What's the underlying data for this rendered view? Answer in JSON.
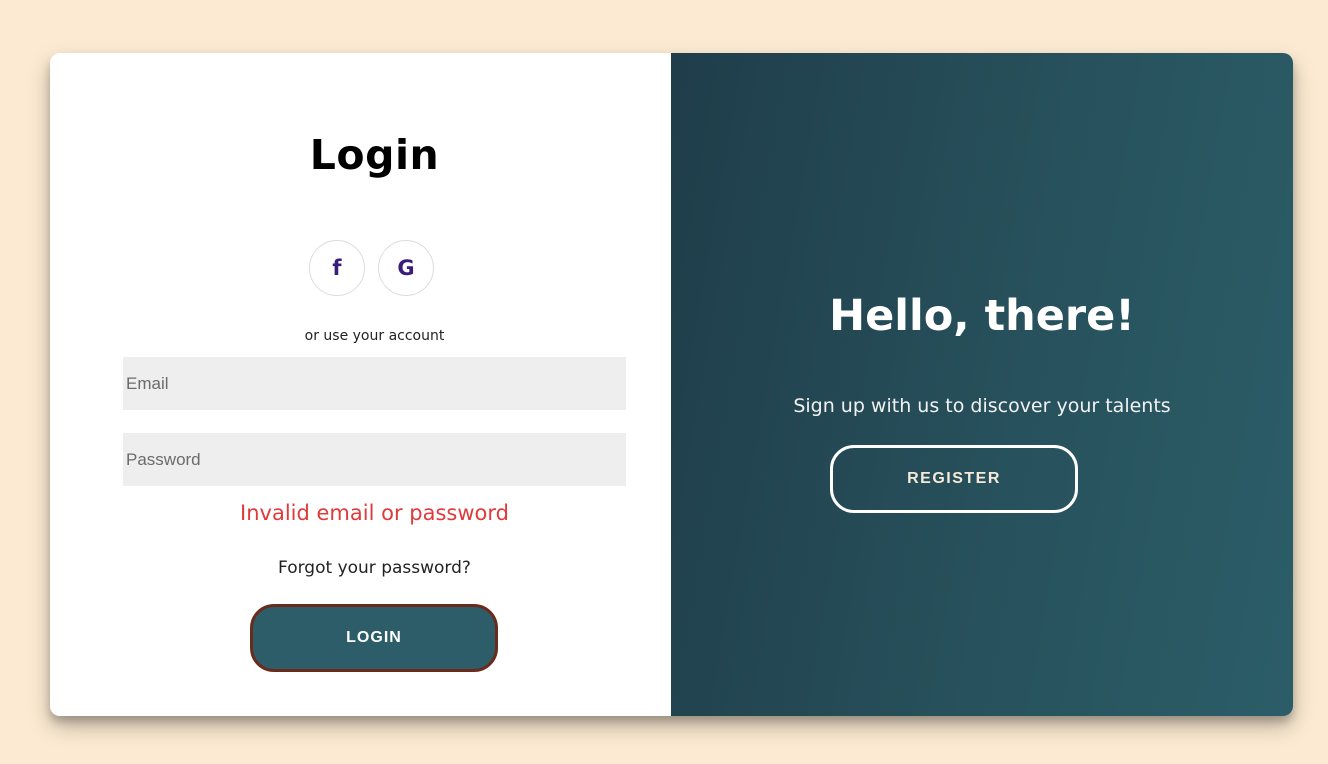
{
  "login": {
    "title": "Login",
    "socials": [
      {
        "label": "f",
        "icon": "facebook-icon"
      },
      {
        "label": "G",
        "icon": "google-icon"
      }
    ],
    "divider_text": "or use your account",
    "email_placeholder": "Email",
    "password_placeholder": "Password",
    "error_message": "Invalid email or password",
    "forgot_link": "Forgot your password?",
    "login_button": "LOGIN"
  },
  "register_panel": {
    "title": "Hello, there!",
    "subtitle": "Sign up with us to discover your talents",
    "register_button": "REGISTER"
  },
  "colors": {
    "background": "#fcebd2",
    "panel_gradient_start": "#1f3d4a",
    "panel_gradient_end": "#2b5d68",
    "login_button_fill": "#2c5d69",
    "login_button_border": "#6b2b1c",
    "error": "#e03a3a",
    "social_icon": "#3a1d7a"
  }
}
